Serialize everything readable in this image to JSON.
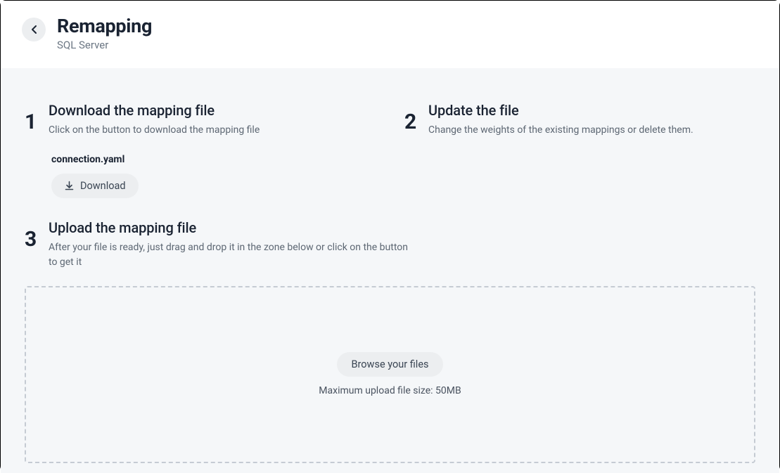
{
  "header": {
    "title": "Remapping",
    "subtitle": "SQL Server"
  },
  "steps": {
    "step1": {
      "number": "1",
      "title": "Download the mapping file",
      "description": "Click on the button to download the mapping file"
    },
    "step2": {
      "number": "2",
      "title": "Update the file",
      "description": "Change the weights of the existing mappings or delete them."
    },
    "step3": {
      "number": "3",
      "title": "Upload the mapping file",
      "description": "After your file is ready, just drag and drop it in the zone below or click on the button to get it"
    }
  },
  "file": {
    "name": "connection.yaml",
    "download_label": "Download"
  },
  "dropzone": {
    "browse_label": "Browse your files",
    "size_hint": "Maximum upload file size: 50MB"
  }
}
